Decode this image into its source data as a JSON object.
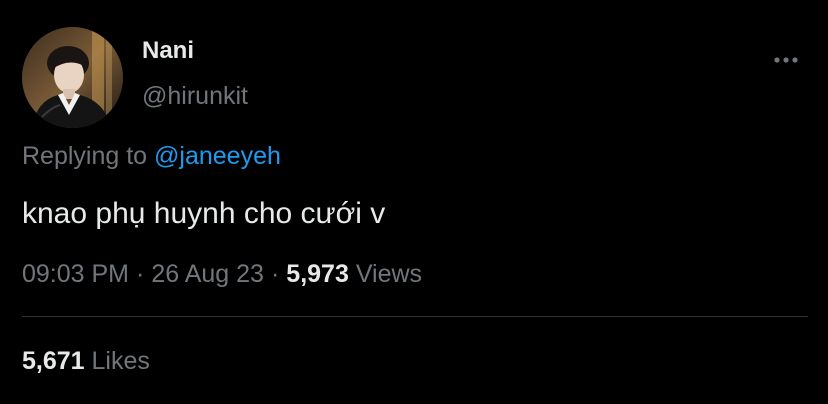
{
  "author": {
    "display_name": "Nani",
    "handle": "@hirunkit",
    "avatar_icon": "profile-photo"
  },
  "reply": {
    "prefix": "Replying to",
    "mention": "@janeeyeh"
  },
  "tweet": {
    "text": "knao phụ huynh cho cưới v"
  },
  "meta": {
    "time": "09:03 PM",
    "date": "26 Aug 23",
    "separator": "·",
    "views_count": "5,973",
    "views_label": "Views"
  },
  "stats": {
    "likes_count": "5,671",
    "likes_label": "Likes"
  },
  "colors": {
    "background": "#000000",
    "primary_text": "#e7e9ea",
    "secondary_text": "#71767b",
    "accent": "#1d9bf0",
    "divider": "#2f3336"
  }
}
